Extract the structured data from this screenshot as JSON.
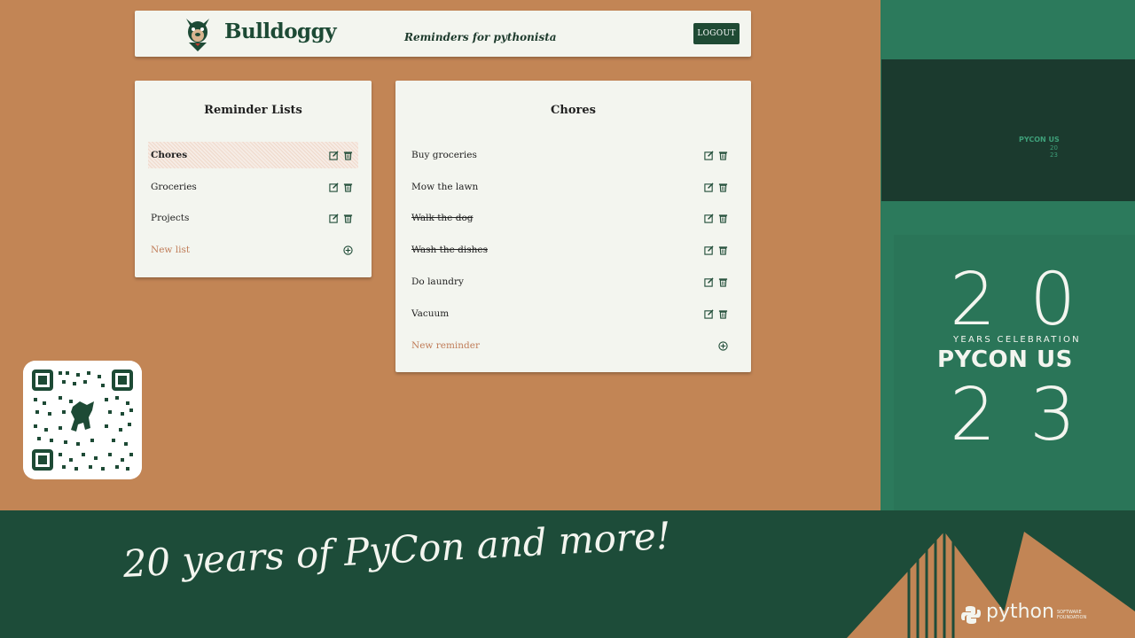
{
  "app": {
    "brand": "Bulldoggy",
    "tagline": "Reminders for pythonista",
    "logout_label": "LOGOUT"
  },
  "lists_panel": {
    "title": "Reminder Lists",
    "items": [
      {
        "label": "Chores",
        "active": true
      },
      {
        "label": "Groceries",
        "active": false
      },
      {
        "label": "Projects",
        "active": false
      }
    ],
    "new_label": "New list"
  },
  "reminders_panel": {
    "title": "Chores",
    "items": [
      {
        "label": "Buy groceries",
        "completed": false
      },
      {
        "label": "Mow the lawn",
        "completed": false
      },
      {
        "label": "Walk the dog",
        "completed": true
      },
      {
        "label": "Wash the dishes",
        "completed": true
      },
      {
        "label": "Do laundry",
        "completed": false
      },
      {
        "label": "Vacuum",
        "completed": false
      }
    ],
    "new_label": "New reminder"
  },
  "conference": {
    "camera_text": "PYCON US",
    "camera_year": "20 23",
    "year_top": "20",
    "subtitle": "YEARS CELEBRATION",
    "name": "PYCON US",
    "year_bottom": "23",
    "banner_text": "20 years of PyCon and more!",
    "psf_name": "python",
    "psf_sub": "SOFTWARE FOUNDATION"
  },
  "colors": {
    "background": "#c28555",
    "card": "#f3f5ef",
    "accent": "#1f4a34",
    "new_item": "#c07d59",
    "conference_green": "#2c7a5c",
    "banner_green": "#1d4c39"
  },
  "icons": {
    "edit": "pencil-square-icon",
    "delete": "trash-icon",
    "add": "plus-circle-icon",
    "logo": "bulldog-icon"
  }
}
